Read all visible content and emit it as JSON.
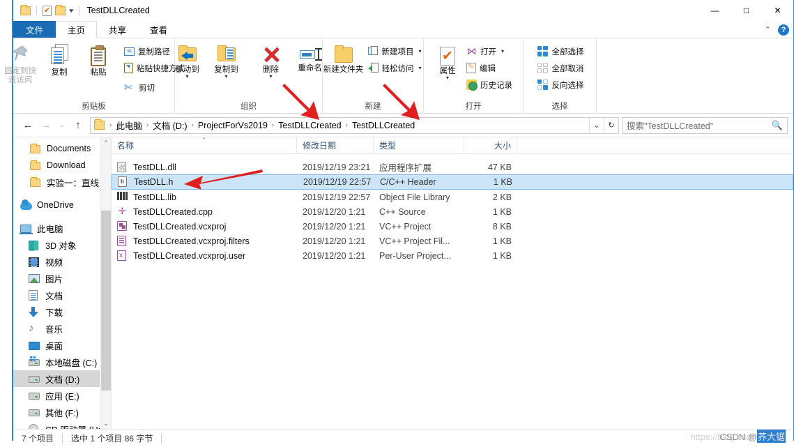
{
  "window": {
    "title": "TestDLLCreated",
    "quick_access": [
      {
        "name": "folder-icon"
      },
      {
        "name": "properties-icon"
      },
      {
        "name": "folder-icon"
      },
      {
        "name": "chevron-down-icon"
      }
    ],
    "controls": {
      "minimize": "—",
      "maximize": "□",
      "close": "✕"
    },
    "collapse_chevron": "⌃",
    "help": "?"
  },
  "tabs": [
    {
      "label": "文件",
      "kind": "file"
    },
    {
      "label": "主页",
      "kind": "active"
    },
    {
      "label": "共享",
      "kind": "normal"
    },
    {
      "label": "查看",
      "kind": "normal"
    }
  ],
  "ribbon": {
    "groups": [
      {
        "label": "剪贴板",
        "big": [
          {
            "label": "固定到快速访问",
            "icon": "pin-icon",
            "disabled": true
          },
          {
            "label": "复制",
            "icon": "copy-icon",
            "disabled": false
          },
          {
            "label": "粘贴",
            "icon": "paste-icon",
            "disabled": false
          }
        ],
        "small": [
          {
            "label": "复制路径",
            "icon": "copy-path-icon"
          },
          {
            "label": "粘贴快捷方式",
            "icon": "paste-shortcut-icon"
          },
          {
            "label": "剪切",
            "icon": "scissors-icon"
          }
        ]
      },
      {
        "label": "组织",
        "big": [
          {
            "label": "移动到",
            "icon": "move-to-icon",
            "caret": true
          },
          {
            "label": "复制到",
            "icon": "copy-to-icon",
            "caret": true
          },
          {
            "label": "删除",
            "icon": "delete-icon",
            "caret": true
          },
          {
            "label": "重命名",
            "icon": "rename-icon",
            "caret": false
          }
        ],
        "small": []
      },
      {
        "label": "新建",
        "big": [
          {
            "label": "新建文件夹",
            "icon": "new-folder-icon",
            "disabled": false
          }
        ],
        "small": [
          {
            "label": "新建项目",
            "icon": "new-item-icon",
            "caret": true
          },
          {
            "label": "轻松访问",
            "icon": "easy-access-icon",
            "caret": true
          }
        ]
      },
      {
        "label": "打开",
        "big": [
          {
            "label": "属性",
            "icon": "properties-icon",
            "caret": true
          }
        ],
        "small": [
          {
            "label": "打开",
            "icon": "visual-studio-icon",
            "caret": true
          },
          {
            "label": "编辑",
            "icon": "edit-icon"
          },
          {
            "label": "历史记录",
            "icon": "history-icon"
          }
        ]
      },
      {
        "label": "选择",
        "big": [],
        "small": [
          {
            "label": "全部选择",
            "icon": "select-all-icon"
          },
          {
            "label": "全部取消",
            "icon": "select-none-icon"
          },
          {
            "label": "反向选择",
            "icon": "invert-selection-icon"
          }
        ]
      }
    ]
  },
  "address_bar": {
    "back": "←",
    "forward": "→",
    "recent": "⌄",
    "up": "↑",
    "breadcrumbs": [
      "此电脑",
      "文档 (D:)",
      "ProjectForVs2019",
      "TestDLLCreated",
      "TestDLLCreated"
    ],
    "separator": "›",
    "dropdown": "⌄",
    "refresh": "↻",
    "search_placeholder": "搜索\"TestDLLCreated\"",
    "search_icon": "⚲"
  },
  "sidebar": {
    "items": [
      {
        "label": "Documents",
        "icon": "folder-icon",
        "indent": 1,
        "selected": false
      },
      {
        "label": "Download",
        "icon": "folder-icon",
        "indent": 1,
        "selected": false
      },
      {
        "label": "实验一：直线生",
        "icon": "folder-icon",
        "indent": 1,
        "selected": false
      },
      {
        "label": "OneDrive",
        "icon": "onedrive-icon",
        "indent": 0,
        "selected": false,
        "gap_before": true
      },
      {
        "label": "此电脑",
        "icon": "this-pc-icon",
        "indent": 0,
        "selected": false,
        "gap_before": true
      },
      {
        "label": "3D 对象",
        "icon": "3d-objects-icon",
        "indent": 2,
        "selected": false
      },
      {
        "label": "视频",
        "icon": "videos-icon",
        "indent": 2,
        "selected": false
      },
      {
        "label": "图片",
        "icon": "pictures-icon",
        "indent": 2,
        "selected": false
      },
      {
        "label": "文档",
        "icon": "documents-icon",
        "indent": 2,
        "selected": false
      },
      {
        "label": "下载",
        "icon": "downloads-icon",
        "indent": 2,
        "selected": false
      },
      {
        "label": "音乐",
        "icon": "music-icon",
        "indent": 2,
        "selected": false
      },
      {
        "label": "桌面",
        "icon": "desktop-icon",
        "indent": 2,
        "selected": false
      },
      {
        "label": "本地磁盘 (C:)",
        "icon": "windows-drive-icon",
        "indent": 2,
        "selected": false
      },
      {
        "label": "文档 (D:)",
        "icon": "drive-icon",
        "indent": 2,
        "selected": true
      },
      {
        "label": "应用 (E:)",
        "icon": "drive-icon",
        "indent": 2,
        "selected": false
      },
      {
        "label": "其他 (F:)",
        "icon": "drive-icon",
        "indent": 2,
        "selected": false
      },
      {
        "label": "CD 驱动器 (H:)",
        "icon": "cd-drive-icon",
        "indent": 2,
        "selected": false
      }
    ],
    "scroll_up": "⌃",
    "scroll_down": "⌄"
  },
  "file_list": {
    "columns": [
      "名称",
      "修改日期",
      "类型",
      "大小"
    ],
    "sort_indicator": "⌃",
    "rows": [
      {
        "name": "TestDLL.dll",
        "date": "2019/12/19 23:21",
        "type": "应用程序扩展",
        "size": "47 KB",
        "icon": "dll-file-icon",
        "selected": false
      },
      {
        "name": "TestDLL.h",
        "date": "2019/12/19 22:57",
        "type": "C/C++ Header",
        "size": "1 KB",
        "icon": "header-file-icon",
        "selected": true
      },
      {
        "name": "TestDLL.lib",
        "date": "2019/12/19 22:57",
        "type": "Object File Library",
        "size": "2 KB",
        "icon": "lib-file-icon",
        "selected": false
      },
      {
        "name": "TestDLLCreated.cpp",
        "date": "2019/12/20 1:21",
        "type": "C++ Source",
        "size": "1 KB",
        "icon": "cpp-file-icon",
        "selected": false
      },
      {
        "name": "TestDLLCreated.vcxproj",
        "date": "2019/12/20 1:21",
        "type": "VC++ Project",
        "size": "8 KB",
        "icon": "vcxproj-file-icon",
        "selected": false
      },
      {
        "name": "TestDLLCreated.vcxproj.filters",
        "date": "2019/12/20 1:21",
        "type": "VC++ Project Fil...",
        "size": "1 KB",
        "icon": "filters-file-icon",
        "selected": false
      },
      {
        "name": "TestDLLCreated.vcxproj.user",
        "date": "2019/12/20 1:21",
        "type": "Per-User Project...",
        "size": "1 KB",
        "icon": "user-file-icon",
        "selected": false
      }
    ]
  },
  "status_bar": {
    "item_count": "7 个项目",
    "selection": "选中 1 个项目  86 字节"
  },
  "watermark": {
    "url": "https://blog.csdn.net/",
    "tag": "CSDN @",
    "name": "荞大锯"
  },
  "colors": {
    "accent": "#2b87d3",
    "file_tab": "#1a6cb5",
    "selection": "#cce4f7",
    "annotation": "#e02020"
  }
}
